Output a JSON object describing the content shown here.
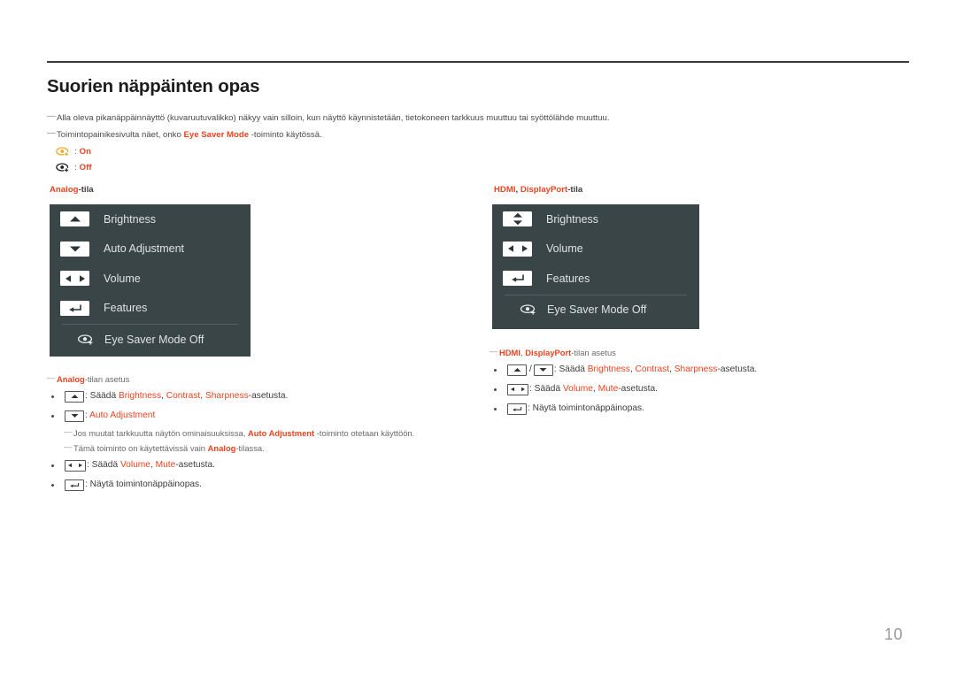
{
  "document": {
    "title": "Suorien näppäinten opas",
    "page_number": "10"
  },
  "intro": {
    "note1": "Alla oleva pikanäppäinnäyttö (kuvaruutuvalikko) näkyy vain silloin, kun näyttö käynnistetään, tietokoneen tarkkuus muuttuu tai syöttölähde muuttuu.",
    "note2_pre": "Toimintopainikesivulta näet, onko ",
    "note2_kw": "Eye Saver Mode",
    "note2_post": " -toiminto käytössä."
  },
  "legend": {
    "on_sep": ":",
    "on_label": "On",
    "off_sep": ":",
    "off_label": "Off",
    "on_icon": "eye-saver-on-icon",
    "off_icon": "eye-saver-off-icon"
  },
  "colors": {
    "accent": "#e8441f",
    "osd_background": "#3a4547",
    "osd_text": "#dfe3e3",
    "page_number": "#9a9a9a"
  },
  "analog": {
    "caption_tag": "Analog",
    "caption_suffix": "-tila",
    "menu": [
      {
        "key_icon": "up-arrow-key",
        "label": "Brightness"
      },
      {
        "key_icon": "down-arrow-key",
        "label": "Auto Adjustment"
      },
      {
        "key_icon": "left-right-arrow-key",
        "label": "Volume"
      },
      {
        "key_icon": "enter-key",
        "label": "Features"
      }
    ],
    "eye_row": {
      "icon": "eye-saver-icon",
      "label": "Eye Saver Mode Off"
    },
    "section_note_tag": "Analog",
    "section_note_rest": "-tilan asetus",
    "bullets": [
      {
        "keys": [
          "up-arrow-key"
        ],
        "pre": ": Säädä ",
        "kw1": "Brightness",
        "mid1": ", ",
        "kw2": "Contrast",
        "mid2": ", ",
        "kw3": "Sharpness",
        "post": "-asetusta."
      },
      {
        "keys": [
          "down-arrow-key"
        ],
        "pre": ": ",
        "kw1": "Auto Adjustment",
        "post": ""
      },
      {
        "keys": [
          "left-right-arrow-key"
        ],
        "pre": ": Säädä ",
        "kw1": "Volume",
        "mid1": ", ",
        "kw2": "Mute",
        "post": "-asetusta."
      },
      {
        "keys": [
          "enter-key"
        ],
        "pre": ": Näytä toimintonäppäinopas.",
        "post": ""
      }
    ],
    "subnote1_pre": "Jos muutat tarkkuutta näytön ominaisuuksissa, ",
    "subnote1_kw": "Auto Adjustment",
    "subnote1_post": " -toiminto otetaan käyttöön.",
    "subnote2_pre": "Tämä toiminto on käytettävissä vain ",
    "subnote2_kw": "Analog",
    "subnote2_post": "-tilassa."
  },
  "hdmi": {
    "caption_tag1": "HDMI",
    "caption_comma": ", ",
    "caption_tag2": "DisplayPort",
    "caption_suffix": "-tila",
    "menu": [
      {
        "key_icon": "up-down-arrow-key",
        "label": "Brightness"
      },
      {
        "key_icon": "left-right-arrow-key",
        "label": "Volume"
      },
      {
        "key_icon": "enter-key",
        "label": "Features"
      }
    ],
    "eye_row": {
      "icon": "eye-saver-icon",
      "label": "Eye Saver Mode Off"
    },
    "section_note_tag1": "HDMI",
    "section_note_comma": ", ",
    "section_note_tag2": "DisplayPort",
    "section_note_rest": "-tilan asetus",
    "bullets": [
      {
        "keys": [
          "up-arrow-key",
          "down-arrow-key"
        ],
        "pre": ": Säädä ",
        "kw1": "Brightness",
        "mid1": ", ",
        "kw2": "Contrast",
        "mid2": ", ",
        "kw3": "Sharpness",
        "post": "-asetusta."
      },
      {
        "keys": [
          "left-right-arrow-key"
        ],
        "pre": ": Säädä ",
        "kw1": "Volume",
        "mid1": ", ",
        "kw2": "Mute",
        "post": "-asetusta."
      },
      {
        "keys": [
          "enter-key"
        ],
        "pre": ": Näytä toimintonäppäinopas.",
        "post": ""
      }
    ]
  }
}
